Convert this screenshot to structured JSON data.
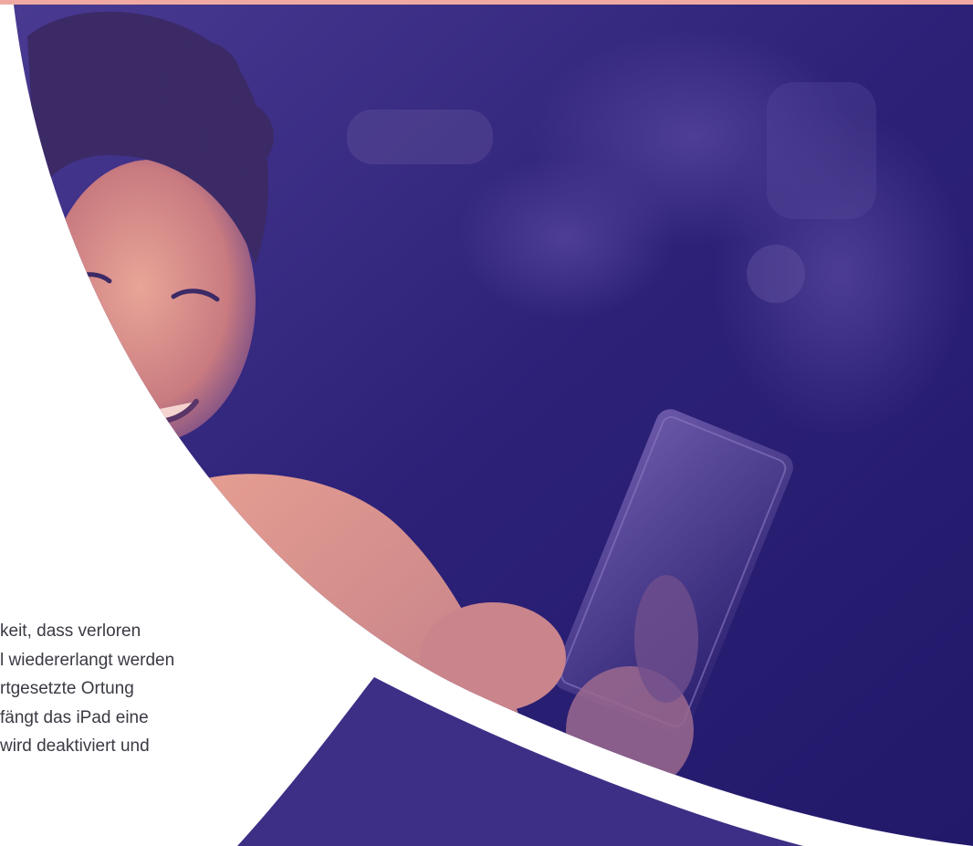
{
  "hero": {
    "image_alt": "Smiling child holding an iPad",
    "colors": {
      "accent_pink": "#f0a9a2",
      "deep_purple": "#2a1f6e",
      "mid_purple": "#3d2f86",
      "skin_tone": "#e39990"
    }
  },
  "body_text": {
    "lines": [
      "keit, dass verloren",
      "l wiedererlangt werden",
      "rtgesetzte Ortung",
      "fängt das iPad eine",
      "wird deaktiviert und"
    ]
  }
}
